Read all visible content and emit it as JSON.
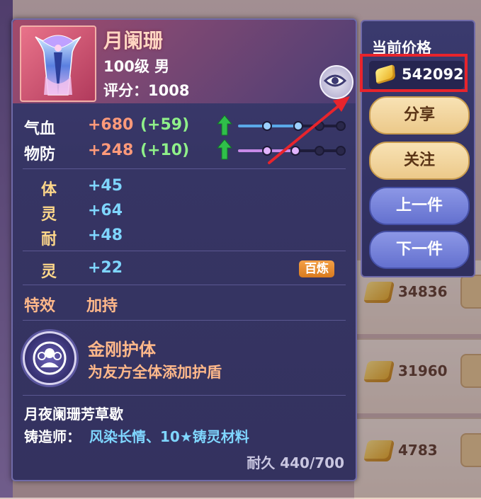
{
  "item": {
    "name": "月阑珊",
    "level_gender": "100级 男",
    "score": "评分：1008"
  },
  "stats": [
    {
      "label": "气血",
      "value": "+680",
      "bonus": "(+59)"
    },
    {
      "label": "物防",
      "value": "+248",
      "bonus": "(+10)"
    }
  ],
  "attributes": [
    {
      "label": "体",
      "value": "+45"
    },
    {
      "label": "灵",
      "value": "+64"
    },
    {
      "label": "耐",
      "value": "+48"
    }
  ],
  "refine": {
    "label": "灵",
    "value": "+22",
    "badge": "百炼"
  },
  "effect": {
    "label": "特效",
    "value": "加持"
  },
  "skill": {
    "name": "金刚护体",
    "desc": "为友方全体添加护盾"
  },
  "flavor": "月夜阑珊芳草歇",
  "maker": {
    "label": "铸造师：",
    "value": "风染长情、10★铸灵材料"
  },
  "durability": "耐久 440/700",
  "side": {
    "title": "当前价格",
    "price": "542092",
    "buttons": {
      "share": "分享",
      "follow": "关注",
      "prev": "上一件",
      "next": "下一件"
    }
  },
  "background_list": {
    "prices": [
      "34836",
      "31960",
      "4783"
    ]
  },
  "colors": {
    "panel": "#363564",
    "highlight_red": "#e8242c",
    "stat_value": "#ff9a7a",
    "stat_bonus": "#8ff089",
    "attr_value": "#7fd6ff",
    "effect_text": "#ffb88a"
  },
  "icons": [
    "eye-icon",
    "up-arrow-icon",
    "gold-ingot-icon",
    "shield-skill-icon",
    "robe-item-icon"
  ]
}
